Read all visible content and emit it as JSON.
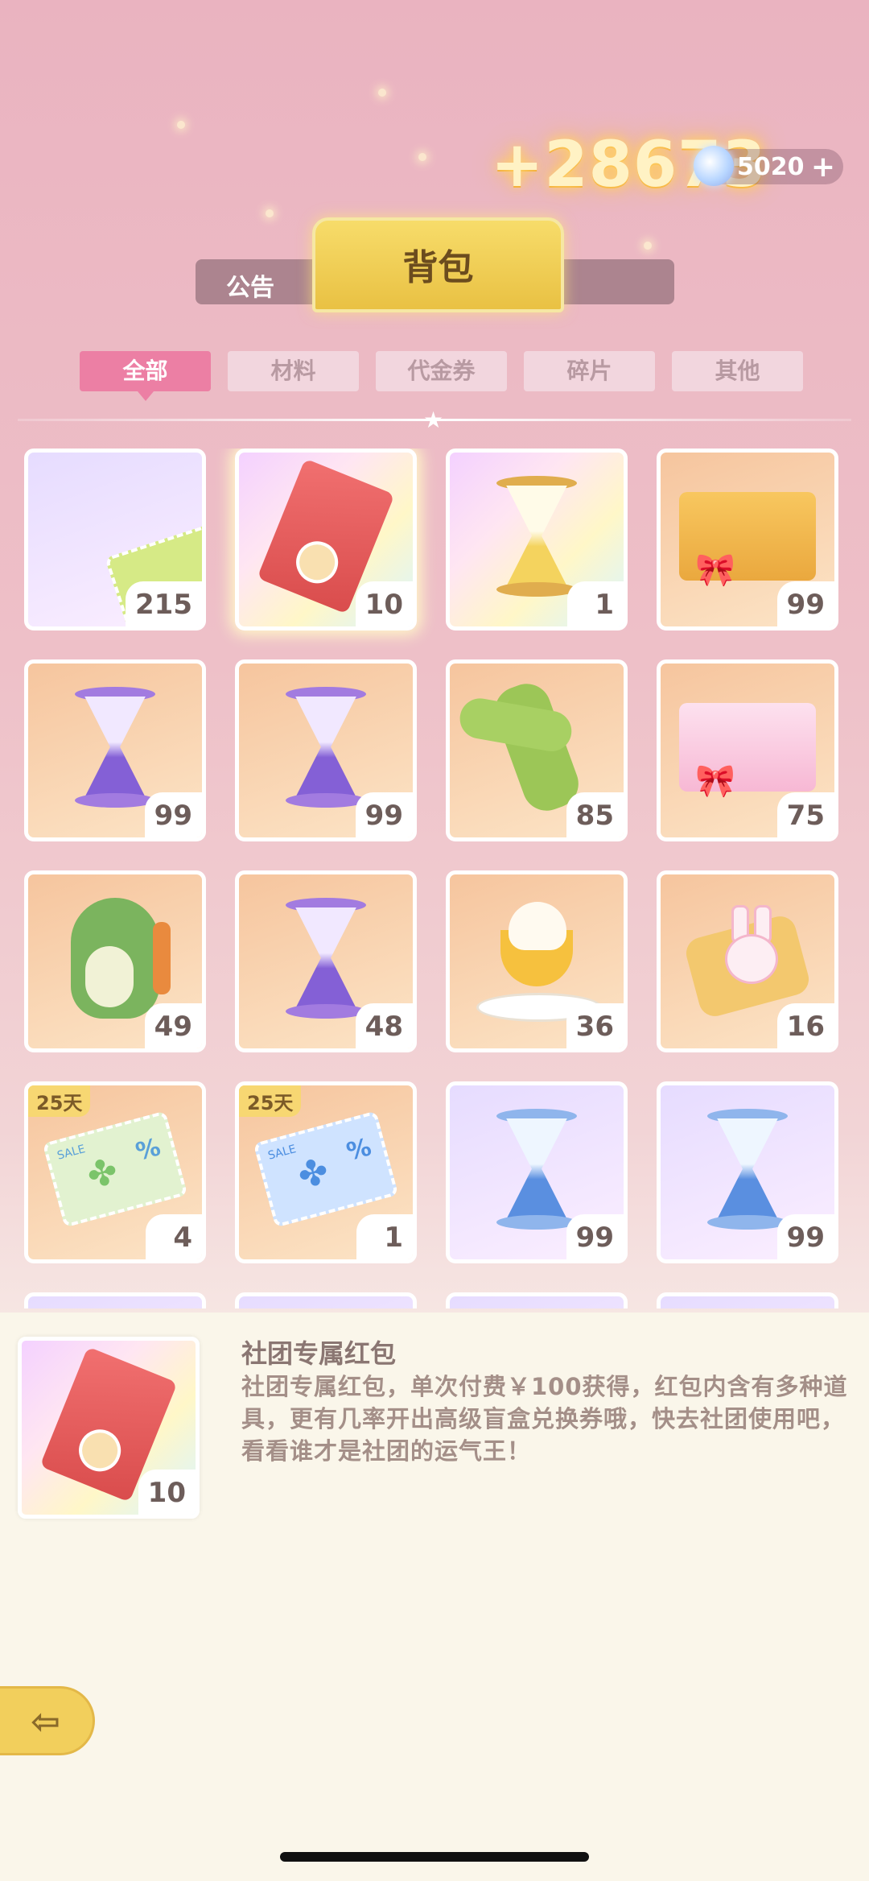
{
  "reward": {
    "text": "+28673"
  },
  "currency": {
    "icon": "gem-icon",
    "value": "5020",
    "plus": "+"
  },
  "header": {
    "notice_label": "公告",
    "title": "背包"
  },
  "tabs": [
    {
      "label": "全部",
      "active": true
    },
    {
      "label": "材料",
      "active": false
    },
    {
      "label": "代金券",
      "active": false
    },
    {
      "label": "碎片",
      "active": false
    },
    {
      "label": "其他",
      "active": false
    }
  ],
  "items": [
    {
      "name": "green-ticket",
      "count": "215",
      "bg": "purple"
    },
    {
      "name": "club-red-envelope",
      "count": "10",
      "bg": "rainbow",
      "selected": true
    },
    {
      "name": "gold-hourglass",
      "count": "1",
      "bg": "rainbow"
    },
    {
      "name": "gold-gift-box",
      "count": "99",
      "bg": "orange"
    },
    {
      "name": "purple-hourglass",
      "count": "99",
      "bg": "orange"
    },
    {
      "name": "purple-hourglass",
      "count": "99",
      "bg": "orange"
    },
    {
      "name": "green-scarf",
      "count": "85",
      "bg": "orange"
    },
    {
      "name": "pink-gift-box",
      "count": "75",
      "bg": "orange"
    },
    {
      "name": "dinosaur-plush",
      "count": "49",
      "bg": "orange"
    },
    {
      "name": "purple-hourglass",
      "count": "48",
      "bg": "orange"
    },
    {
      "name": "parfait",
      "count": "36",
      "bg": "orange"
    },
    {
      "name": "bunny-bag",
      "count": "16",
      "bg": "orange"
    },
    {
      "name": "green-sale-coupon",
      "count": "4",
      "bg": "orange",
      "days": "25天"
    },
    {
      "name": "blue-sale-coupon",
      "count": "1",
      "bg": "orange",
      "days": "25天"
    },
    {
      "name": "blue-hourglass",
      "count": "99",
      "bg": "purple"
    },
    {
      "name": "blue-hourglass",
      "count": "99",
      "bg": "purple"
    }
  ],
  "detail": {
    "title": "社团专属红包",
    "description": "社团专属红包，单次付费￥100获得，红包内含有多种道具，更有几率开出高级盲盒兑换券哦，快去社团使用吧，看看谁才是社团的运气王！",
    "count": "10"
  },
  "coupon_text": {
    "sale": "SALE",
    "percent": "%"
  },
  "back_button": {
    "icon": "back-arrow-icon",
    "glyph": "⇦"
  }
}
